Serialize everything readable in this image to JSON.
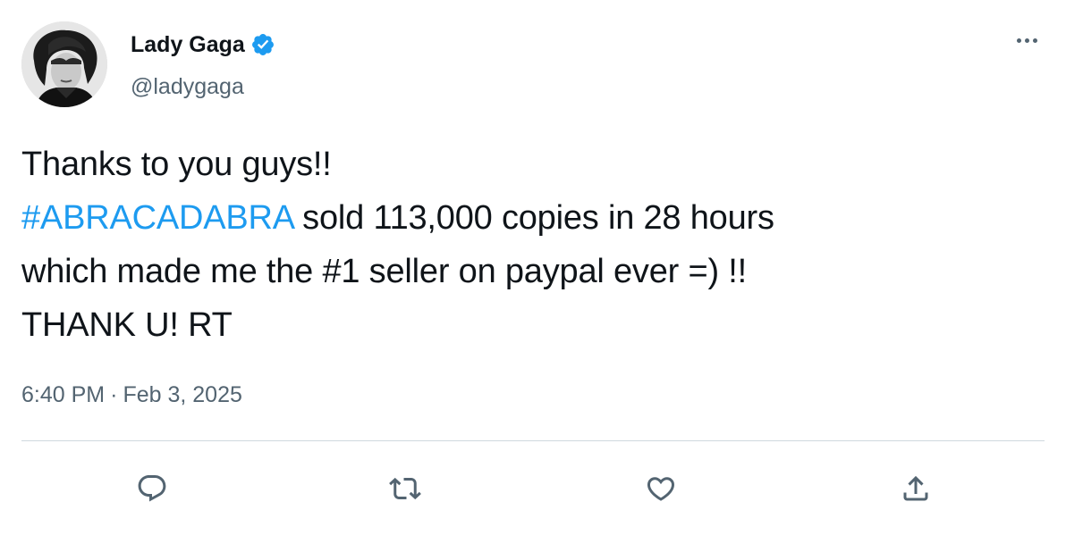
{
  "author": {
    "display_name": "Lady Gaga",
    "handle": "@ladygaga",
    "verified": true
  },
  "tweet": {
    "line1": "Thanks to you guys!!",
    "hashtag": "#ABRACADABRA",
    "line2_rest": " sold 113,000 copies in 28 hours",
    "line3": "which made me the #1 seller on paypal ever =) !!",
    "line4": "THANK U! RT"
  },
  "meta": {
    "time": "6:40 PM",
    "separator": "·",
    "date": "Feb 3, 2025"
  },
  "actions": [
    {
      "name": "reply",
      "icon": "reply-icon"
    },
    {
      "name": "retweet",
      "icon": "retweet-icon"
    },
    {
      "name": "like",
      "icon": "heart-icon"
    },
    {
      "name": "share",
      "icon": "share-icon"
    }
  ],
  "colors": {
    "text": "#0f1419",
    "secondary": "#536471",
    "link": "#1d9bf0",
    "divider": "#cfd9de",
    "verified": "#1d9bf0"
  }
}
